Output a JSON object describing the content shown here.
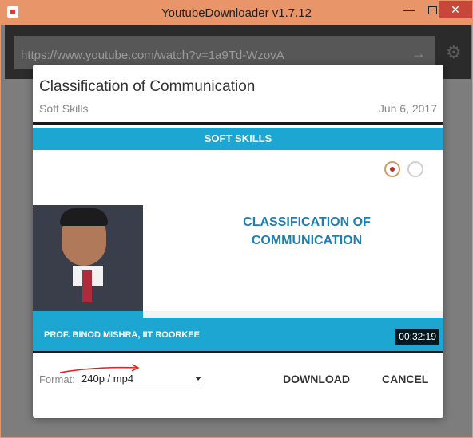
{
  "window": {
    "title": "YoutubeDownloader v1.7.12",
    "min_symbol": "—",
    "close_symbol": "✕"
  },
  "topbar": {
    "url_value": "https://www.youtube.com/watch?v=1a9Td-WzovA",
    "go_icon": "arrow-right-icon",
    "settings_icon": "gear-icon"
  },
  "dialog": {
    "video_title": "Classification of Communication",
    "channel": "Soft Skills",
    "date": "Jun 6, 2017",
    "thumbnail": {
      "banner_text": "SOFT SKILLS",
      "slide_title": "CLASSIFICATION OF COMMUNICATION",
      "presenter": "PROF. BINOD MISHRA, IIT ROORKEE",
      "duration": "00:32:19"
    },
    "format_label": "Format:",
    "format_value": "240p / mp4",
    "download_label": "DOWNLOAD",
    "cancel_label": "CANCEL"
  },
  "colors": {
    "titlebar": "#e8956a",
    "banner": "#1ea6d2",
    "slide_title": "#1d7fb3",
    "close_button": "#c7483a",
    "annotation": "#e02020"
  }
}
